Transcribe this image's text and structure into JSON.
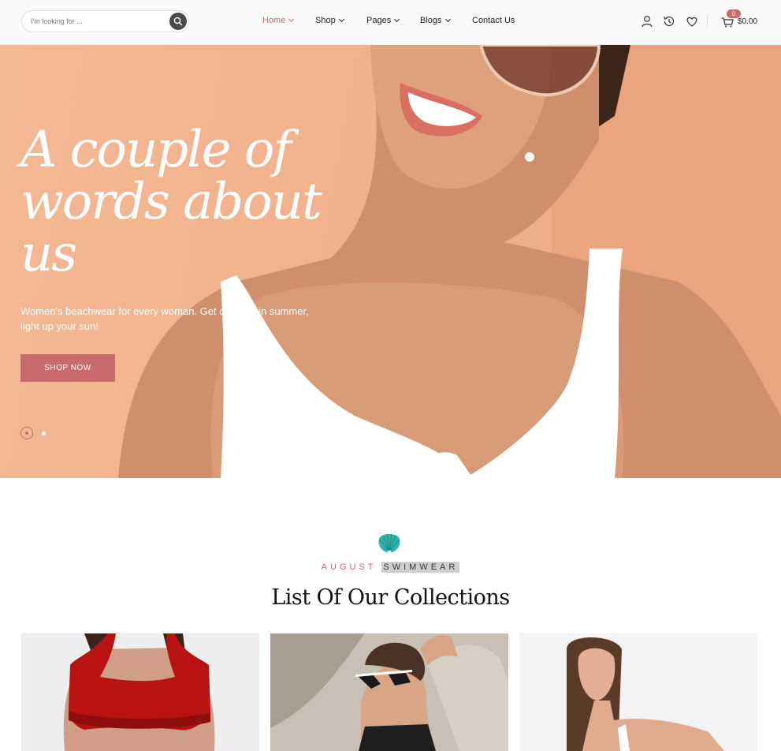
{
  "header": {
    "search_placeholder": "I'm looking for ...",
    "nav": [
      {
        "label": "Home",
        "active": true
      },
      {
        "label": "Shop",
        "active": false
      },
      {
        "label": "Pages",
        "active": false
      },
      {
        "label": "Blogs",
        "active": false
      },
      {
        "label": "Contact Us",
        "active": false
      }
    ],
    "cart_count": "0",
    "cart_total": "$0.00"
  },
  "hero": {
    "title": "A couple of words about us",
    "subtitle": "Women's beachwear for every woman. Get dressed in summer, light up your sun!",
    "cta": "SHOP NOW"
  },
  "collections": {
    "kicker_part1": "AUGUST",
    "kicker_part2": "SWIMWEAR",
    "title": "List Of Our Collections"
  },
  "colors": {
    "accent": "#c66b6b",
    "hero_bg": "#f2b48f",
    "shell": "#2fb3a8"
  }
}
